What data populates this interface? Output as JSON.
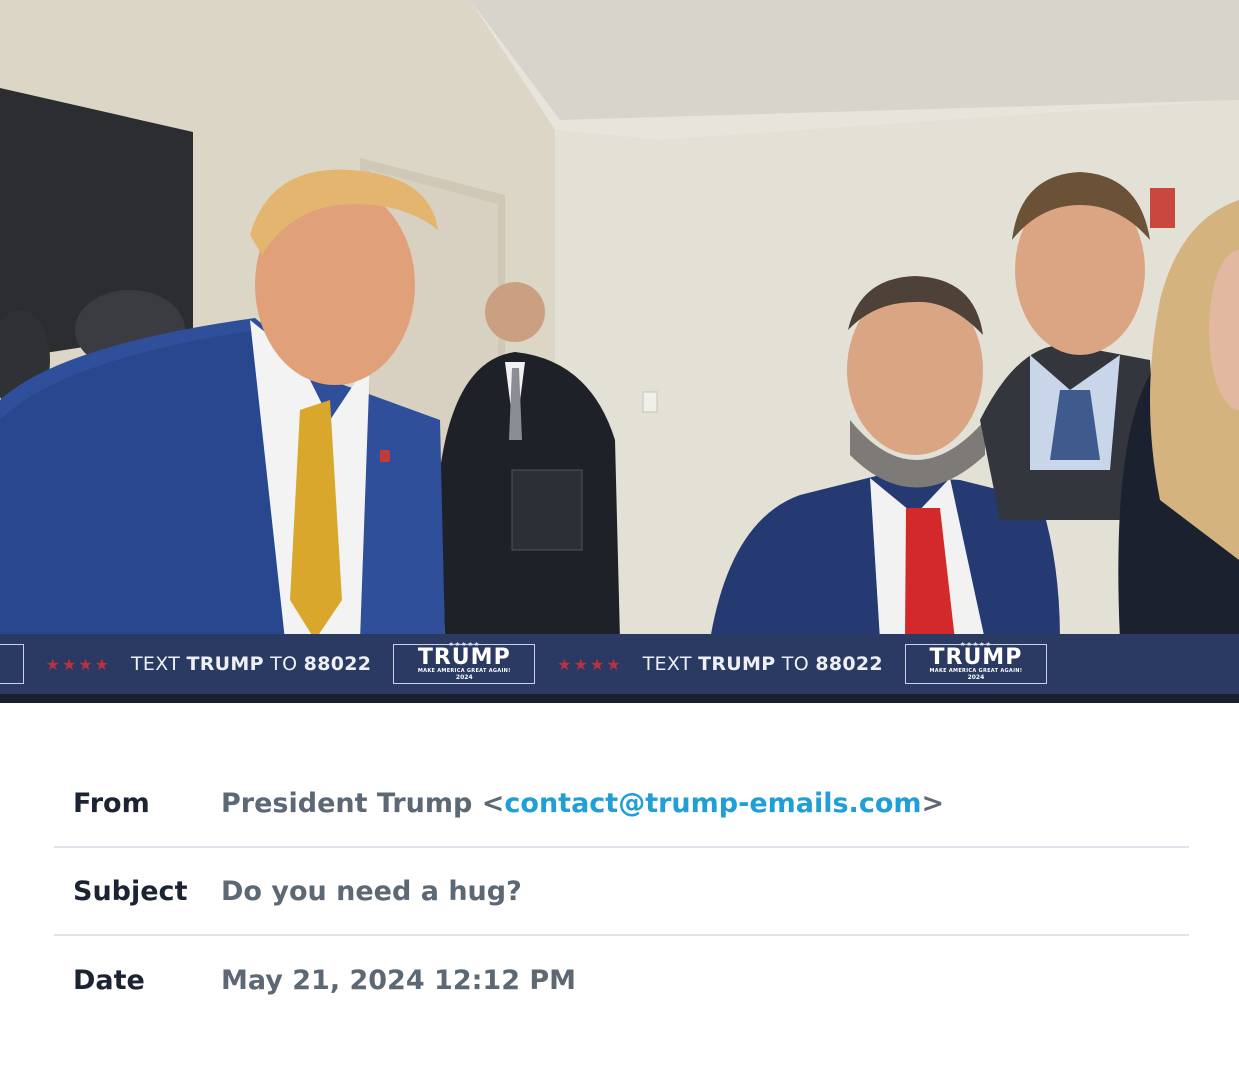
{
  "banner": {
    "logo_stars": "★★★★★",
    "logo_name": "TRUMP",
    "logo_tag": "MAKE AMERICA GREAT AGAIN!",
    "logo_year": "2024",
    "star_run": "★★★★",
    "cta_prefix": "TEXT ",
    "cta_name": "TRUMP",
    "cta_mid": " TO ",
    "cta_number": "88022"
  },
  "email": {
    "from_label": "From",
    "from_name": "President Trump <",
    "from_address": "contact@trump-emails.com",
    "from_suffix": ">",
    "subject_label": "Subject",
    "subject_value": "Do you need a hug?",
    "date_label": "Date",
    "date_value": "May 21, 2024 12:12 PM"
  },
  "colors": {
    "banner_bg": "#2a3a63",
    "link": "#1f9ed8",
    "label": "#1c2433",
    "value": "#5d6875"
  }
}
